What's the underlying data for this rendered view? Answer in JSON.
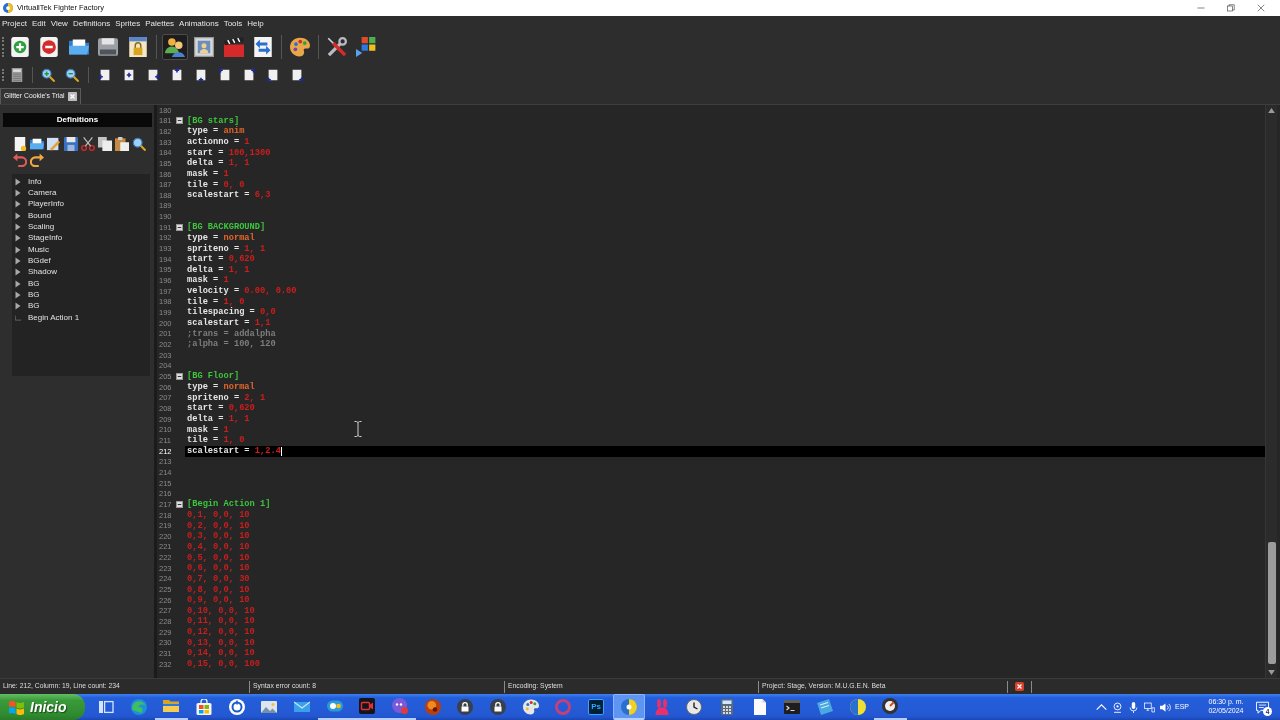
{
  "window": {
    "title": "VirtuallTek Fighter Factory"
  },
  "menu": [
    "Project",
    "Edit",
    "View",
    "Definitions",
    "Sprites",
    "Palettes",
    "Animations",
    "Tools",
    "Help"
  ],
  "toolbar_main": [
    [
      {
        "kind": "add",
        "pressed": false
      },
      {
        "kind": "remove",
        "pressed": false
      },
      {
        "kind": "open",
        "pressed": false
      },
      {
        "kind": "save",
        "pressed": false
      },
      {
        "kind": "lock",
        "pressed": false
      }
    ],
    [
      {
        "kind": "people",
        "pressed": true
      },
      {
        "kind": "portrait",
        "pressed": false
      },
      {
        "kind": "clapper",
        "pressed": false
      },
      {
        "kind": "swap",
        "pressed": false
      }
    ],
    [
      {
        "kind": "palette",
        "pressed": false
      }
    ],
    [
      {
        "kind": "tools",
        "pressed": false
      },
      {
        "kind": "windows",
        "pressed": false
      }
    ]
  ],
  "toolbar_edit": [
    [
      {
        "kind": "sheet"
      }
    ],
    [
      {
        "kind": "zoomin"
      },
      {
        "kind": "zoomout"
      }
    ],
    [
      {
        "kind": "left"
      },
      {
        "kind": "center"
      },
      {
        "kind": "right"
      },
      {
        "kind": "top"
      },
      {
        "kind": "bottom"
      },
      {
        "kind": "topleft"
      },
      {
        "kind": "topright"
      },
      {
        "kind": "bottomleft"
      },
      {
        "kind": "bottomright"
      }
    ]
  ],
  "tabs": [
    {
      "label": "Glitter Cookie's Trial",
      "selected": true
    }
  ],
  "definitions": {
    "title": "Definitions",
    "tools": [
      [
        {
          "kind": "new"
        },
        {
          "kind": "open"
        },
        {
          "kind": "edit"
        },
        {
          "kind": "save"
        },
        {
          "kind": "cut"
        },
        {
          "kind": "copy"
        },
        {
          "kind": "paste"
        },
        {
          "kind": "search"
        }
      ],
      [
        {
          "kind": "undo"
        },
        {
          "kind": "redo"
        }
      ]
    ],
    "tree": [
      {
        "label": "Info",
        "kind": "group",
        "expanded": false
      },
      {
        "label": "Camera",
        "kind": "group",
        "expanded": false
      },
      {
        "label": "PlayerInfo",
        "kind": "group",
        "expanded": false
      },
      {
        "label": "Bound",
        "kind": "group",
        "expanded": false
      },
      {
        "label": "Scaling",
        "kind": "group",
        "expanded": false
      },
      {
        "label": "StageInfo",
        "kind": "group",
        "expanded": false
      },
      {
        "label": "Music",
        "kind": "group",
        "expanded": false
      },
      {
        "label": "BGdef",
        "kind": "group",
        "expanded": false
      },
      {
        "label": "Shadow",
        "kind": "group",
        "expanded": false
      },
      {
        "label": "BG",
        "kind": "group",
        "expanded": false
      },
      {
        "label": "BG",
        "kind": "group",
        "expanded": false
      },
      {
        "label": "BG",
        "kind": "group",
        "expanded": false
      },
      {
        "label": "Begin Action 1",
        "kind": "leaf"
      }
    ]
  },
  "editor": {
    "lines": [
      {
        "number": "180",
        "kind": "blank",
        "current": false
      },
      {
        "number": "181",
        "kind": "section",
        "text": "[BG stars]",
        "expanded": true,
        "current": false
      },
      {
        "number": "182",
        "kind": "setting",
        "key": "type",
        "sign": "=",
        "value": "anim",
        "keyword": true,
        "current": false
      },
      {
        "number": "183",
        "kind": "setting",
        "key": "actionno",
        "sign": "=",
        "value": "1",
        "keyword": false,
        "current": false
      },
      {
        "number": "184",
        "kind": "setting",
        "key": "start",
        "sign": "=",
        "value": "100,1300",
        "keyword": false,
        "current": false
      },
      {
        "number": "185",
        "kind": "setting",
        "key": "delta",
        "sign": "=",
        "value": "1, 1",
        "keyword": false,
        "current": false
      },
      {
        "number": "186",
        "kind": "setting",
        "key": "mask",
        "sign": "=",
        "value": "1",
        "keyword": false,
        "current": false
      },
      {
        "number": "187",
        "kind": "setting",
        "key": "tile",
        "sign": "=",
        "value": "0, 0",
        "keyword": false,
        "current": false
      },
      {
        "number": "188",
        "kind": "setting",
        "key": "scalestart",
        "sign": "=",
        "value": "6,3",
        "keyword": false,
        "current": false
      },
      {
        "number": "189",
        "kind": "blank",
        "current": false
      },
      {
        "number": "190",
        "kind": "blank",
        "current": false
      },
      {
        "number": "191",
        "kind": "section",
        "text": "[BG BACKGROUND]",
        "expanded": true,
        "current": false
      },
      {
        "number": "192",
        "kind": "setting",
        "key": "type",
        "sign": "=",
        "value": "normal",
        "keyword": true,
        "current": false
      },
      {
        "number": "193",
        "kind": "setting",
        "key": "spriteno",
        "sign": "=",
        "value": "1, 1",
        "keyword": false,
        "current": false
      },
      {
        "number": "194",
        "kind": "setting",
        "key": "start",
        "sign": "=",
        "value": "0,620",
        "keyword": false,
        "current": false
      },
      {
        "number": "195",
        "kind": "setting",
        "key": "delta",
        "sign": "=",
        "value": "1, 1",
        "keyword": false,
        "current": false
      },
      {
        "number": "196",
        "kind": "setting",
        "key": "mask",
        "sign": "=",
        "value": "1",
        "keyword": false,
        "current": false
      },
      {
        "number": "197",
        "kind": "setting",
        "key": "velocity",
        "sign": "=",
        "value": "0.00, 0.00",
        "keyword": false,
        "current": false
      },
      {
        "number": "198",
        "kind": "setting",
        "key": "tile",
        "sign": "=",
        "value": "1, 0",
        "keyword": false,
        "current": false
      },
      {
        "number": "199",
        "kind": "setting",
        "key": "tilespacing",
        "sign": "=",
        "value": "0,0",
        "keyword": false,
        "current": false
      },
      {
        "number": "200",
        "kind": "setting",
        "key": "scalestart",
        "sign": "=",
        "value": "1,1",
        "keyword": false,
        "current": false
      },
      {
        "number": "201",
        "kind": "comment",
        "text": ";trans = addalpha",
        "current": false
      },
      {
        "number": "202",
        "kind": "comment",
        "text": ";alpha = 100, 120",
        "current": false
      },
      {
        "number": "203",
        "kind": "blank",
        "current": false
      },
      {
        "number": "204",
        "kind": "blank",
        "current": false
      },
      {
        "number": "205",
        "kind": "section",
        "text": "[BG Floor]",
        "expanded": true,
        "current": false
      },
      {
        "number": "206",
        "kind": "setting",
        "key": "type",
        "sign": "=",
        "value": "normal",
        "keyword": true,
        "current": false
      },
      {
        "number": "207",
        "kind": "setting",
        "key": "spriteno",
        "sign": "=",
        "value": "2, 1",
        "keyword": false,
        "current": false
      },
      {
        "number": "208",
        "kind": "setting",
        "key": "start",
        "sign": "=",
        "value": "0,620",
        "keyword": false,
        "current": false
      },
      {
        "number": "209",
        "kind": "setting",
        "key": "delta",
        "sign": "=",
        "value": "1, 1",
        "keyword": false,
        "current": false
      },
      {
        "number": "210",
        "kind": "setting",
        "key": "mask",
        "sign": "=",
        "value": "1",
        "keyword": false,
        "current": false
      },
      {
        "number": "211",
        "kind": "setting",
        "key": "tile",
        "sign": "=",
        "value": "1, 0",
        "keyword": false,
        "current": false
      },
      {
        "number": "212",
        "kind": "setting",
        "key": "scalestart",
        "sign": "=",
        "value": "1,2.4",
        "keyword": false,
        "current": true
      },
      {
        "number": "213",
        "kind": "blank",
        "current": false
      },
      {
        "number": "214",
        "kind": "blank",
        "current": false
      },
      {
        "number": "215",
        "kind": "blank",
        "current": false
      },
      {
        "number": "216",
        "kind": "blank",
        "current": false
      },
      {
        "number": "217",
        "kind": "section",
        "text": "[Begin Action 1]",
        "expanded": true,
        "current": false
      },
      {
        "number": "218",
        "kind": "data",
        "text": "0,1, 0,0, 10",
        "current": false
      },
      {
        "number": "219",
        "kind": "data",
        "text": "0,2, 0,0, 10",
        "current": false
      },
      {
        "number": "220",
        "kind": "data",
        "text": "0,3, 0,0, 10",
        "current": false
      },
      {
        "number": "221",
        "kind": "data",
        "text": "0,4, 0,0, 10",
        "current": false
      },
      {
        "number": "222",
        "kind": "data",
        "text": "0,5, 0,0, 10",
        "current": false
      },
      {
        "number": "223",
        "kind": "data",
        "text": "0,6, 0,0, 10",
        "current": false
      },
      {
        "number": "224",
        "kind": "data",
        "text": "0,7, 0,0, 30",
        "current": false
      },
      {
        "number": "225",
        "kind": "data",
        "text": "0,8, 0,0, 10",
        "current": false
      },
      {
        "number": "226",
        "kind": "data",
        "text": "0,9, 0,0, 10",
        "current": false
      },
      {
        "number": "227",
        "kind": "data",
        "text": "0,10, 0,0, 10",
        "current": false
      },
      {
        "number": "228",
        "kind": "data",
        "text": "0,11, 0,0, 10",
        "current": false
      },
      {
        "number": "229",
        "kind": "data",
        "text": "0,12, 0,0, 10",
        "current": false
      },
      {
        "number": "230",
        "kind": "data",
        "text": "0,13, 0,0, 10",
        "current": false
      },
      {
        "number": "231",
        "kind": "data",
        "text": "0,14, 0,0, 10",
        "current": false
      },
      {
        "number": "232",
        "kind": "data",
        "text": "0,15, 0,0, 100",
        "current": false
      }
    ]
  },
  "status_bar": {
    "position": "Line: 212, Column: 19, Line count: 234",
    "errors": "Syntax error count: 8",
    "encoding": "Encoding: System",
    "project": "Project: Stage, Version: M.U.G.E.N. Beta"
  },
  "taskbar": {
    "start": "Inicio",
    "apps": [
      {
        "kind": "taskview",
        "running": false,
        "selected": false
      },
      {
        "kind": "swirl",
        "running": false,
        "selected": false
      },
      {
        "kind": "folder",
        "running": true,
        "selected": false
      },
      {
        "kind": "store",
        "running": false,
        "selected": false
      },
      {
        "kind": "ring",
        "running": false,
        "selected": false
      },
      {
        "kind": "photos",
        "running": false,
        "selected": false
      },
      {
        "kind": "mail",
        "running": false,
        "selected": false
      },
      {
        "kind": "meet",
        "running": true,
        "selected": false
      },
      {
        "kind": "camera",
        "running": true,
        "selected": false
      },
      {
        "kind": "chat",
        "running": true,
        "selected": false
      },
      {
        "kind": "orb",
        "running": false,
        "selected": false
      },
      {
        "kind": "lock",
        "running": false,
        "selected": false
      },
      {
        "kind": "lock",
        "running": false,
        "selected": false
      },
      {
        "kind": "paint",
        "running": false,
        "selected": false
      },
      {
        "kind": "halo",
        "running": false,
        "selected": false
      },
      {
        "kind": "tile",
        "label": "Ps",
        "running": false,
        "selected": false
      },
      {
        "kind": "emblem",
        "running": true,
        "selected": true
      },
      {
        "kind": "bunny",
        "running": false,
        "selected": false
      },
      {
        "kind": "clock",
        "running": false,
        "selected": false
      },
      {
        "kind": "calculator",
        "running": false,
        "selected": false
      },
      {
        "kind": "page",
        "running": false,
        "selected": false
      },
      {
        "kind": "terminal",
        "running": false,
        "selected": false
      },
      {
        "kind": "notes",
        "running": false,
        "selected": false
      },
      {
        "kind": "halfmoon",
        "running": false,
        "selected": false
      },
      {
        "kind": "dial",
        "running": true,
        "selected": false
      }
    ],
    "language": "ESP",
    "time": "06:30 p. m.",
    "date": "02/05/2024",
    "notifications": "4"
  }
}
